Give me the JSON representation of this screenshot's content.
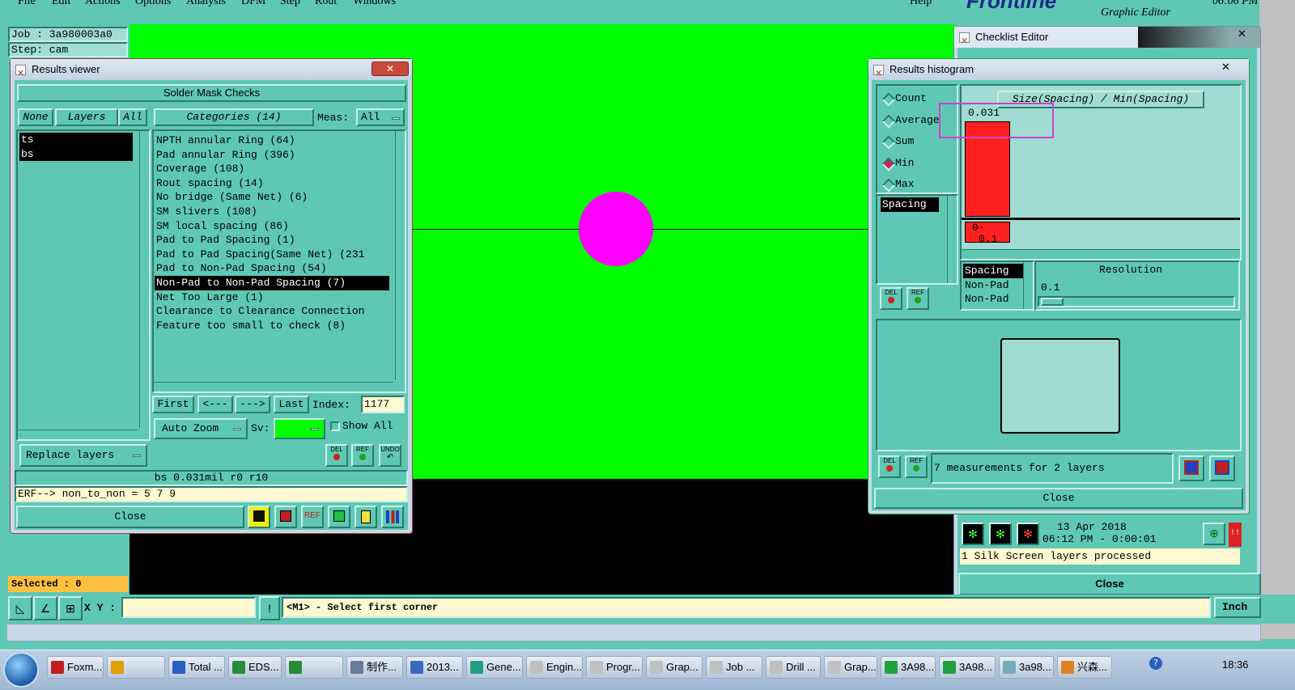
{
  "menubar": {
    "items": [
      "File",
      "Edit",
      "Actions",
      "Options",
      "Analysis",
      "DFM",
      "Step",
      "Rout",
      "Windows"
    ],
    "help": "Help",
    "brand": "Frontline",
    "brand_sub": "Graphic Editor",
    "clock": "06:06 PM"
  },
  "job_info": {
    "job": "Job : 3a980003a0",
    "step": "Step: cam",
    "selected": "Selected : 0"
  },
  "canvas": {
    "background": "#00ff00",
    "pad_color": "#ff00ff"
  },
  "results_viewer": {
    "title": "Results viewer",
    "header": "Solder Mask Checks",
    "none_btn": "None",
    "layers_btn": "Layers",
    "all_btn": "All",
    "categories_btn": "Categories (14)",
    "meas_label": "Meas:",
    "meas_value": "All",
    "layers": [
      "ts",
      "bs"
    ],
    "categories": [
      "NPTH annular Ring (64)",
      "Pad annular Ring (396)",
      "Coverage (108)",
      "Rout spacing (14)",
      "No bridge (Same Net) (6)",
      "SM slivers (108)",
      "SM local spacing (86)",
      "Pad to Pad Spacing (1)",
      "Pad to Pad Spacing(Same Net) (231",
      "Pad to Non-Pad Spacing (54)",
      "Non-Pad to Non-Pad Spacing (7)",
      "Net Too Large (1)",
      "Clearance to Clearance Connection",
      "Feature too small to check (8)"
    ],
    "selected_category_index": 10,
    "first_btn": "First",
    "prev_btn": "<---",
    "next_btn": "--->",
    "last_btn": "Last",
    "index_label": "Index:",
    "index_value": "1177",
    "zoom_value": "Auto Zoom",
    "sv_label": "Sv:",
    "show_all": "Show All",
    "replace_layers": "Replace layers",
    "del": "DEL",
    "ref": "REF",
    "undo": "UNDO",
    "status": "bs 0.031mil  r0  r10",
    "erf": "ERF--> non_to_non = 5 7 9",
    "close": "Close"
  },
  "histogram": {
    "title": "Results histogram",
    "modes": [
      "Count",
      "Average",
      "Sum",
      "Min",
      "Max"
    ],
    "selected_mode": "Min",
    "chart_title": "Size(Spacing) / Min(Spacing)",
    "bar_value_label": "0.031",
    "bar_range_label_top": "0-",
    "bar_range_label_bottom": "0.1",
    "list_item": "Spacing",
    "sub_list": [
      "Spacing",
      "Non-Pad",
      "Non-Pad"
    ],
    "resolution_label": "Resolution",
    "resolution_value": "0.1",
    "del": "DEL",
    "ref": "REF",
    "measurements": "7 measurements for 2 layers",
    "close": "Close"
  },
  "checklist_editor": {
    "title": "Checklist Editor",
    "date": "13 Apr 2018",
    "time": "06:12 PM - 0:00:01",
    "status": "1 Silk Screen layers processed",
    "close": "Close"
  },
  "bottom_bar": {
    "xy_label": "X Y :",
    "xy_value": "",
    "prompt": "<M1> - Select first corner",
    "units": "Inch"
  },
  "taskbar": {
    "items": [
      "Foxm...",
      "",
      "Total ...",
      "EDS...",
      "",
      "制作...",
      "2013...",
      "Gene...",
      "Engin...",
      "Progr...",
      "Grap...",
      "Job ...",
      "Drill ...",
      "Grap...",
      "3A98...",
      "3A98...",
      "3a98...",
      "兴森..."
    ],
    "clock": "18:36"
  }
}
